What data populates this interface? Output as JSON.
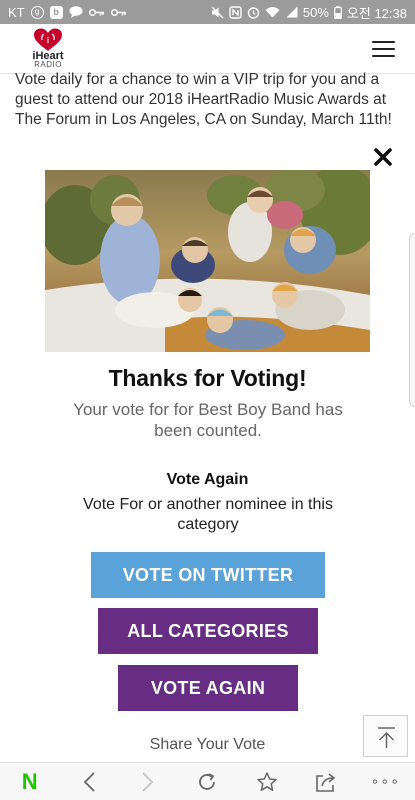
{
  "status_bar": {
    "carrier": "KT",
    "battery": "50%",
    "time_label": "오전 12:38",
    "icons": [
      "circle-g-icon",
      "beatport-icon",
      "chat-bubble-icon",
      "key-icon",
      "key-icon",
      "mute-icon",
      "nfc-icon",
      "alarm-icon",
      "wifi-icon",
      "signal-icon"
    ]
  },
  "header": {
    "logo_line1": "iHeart",
    "logo_line2": "RADIO"
  },
  "article": {
    "text": "Vote daily for a chance to win a VIP trip for you and a guest to attend our 2018 iHeartRadio Music Awards at The Forum in Los Angeles, CA on Sunday, March 11th!"
  },
  "modal": {
    "close_glyph": "✕",
    "title": "Thanks for Voting!",
    "message": "Your vote for for Best Boy Band has been counted.",
    "vote_again_title": "Vote Again",
    "vote_again_desc": "Vote For or another nominee in this category",
    "buttons": {
      "twitter": "VOTE ON TWITTER",
      "categories": "ALL CATEGORIES",
      "vote_again": "VOTE AGAIN"
    },
    "share_label": "Share Your Vote"
  },
  "colors": {
    "twitter_blue": "#5aa3d8",
    "purple": "#662d83",
    "iheart_red": "#c6002b",
    "naver_green": "#1ec800"
  },
  "browser_bar": {
    "naver_label": "N",
    "more_label": "∘∘∘"
  }
}
